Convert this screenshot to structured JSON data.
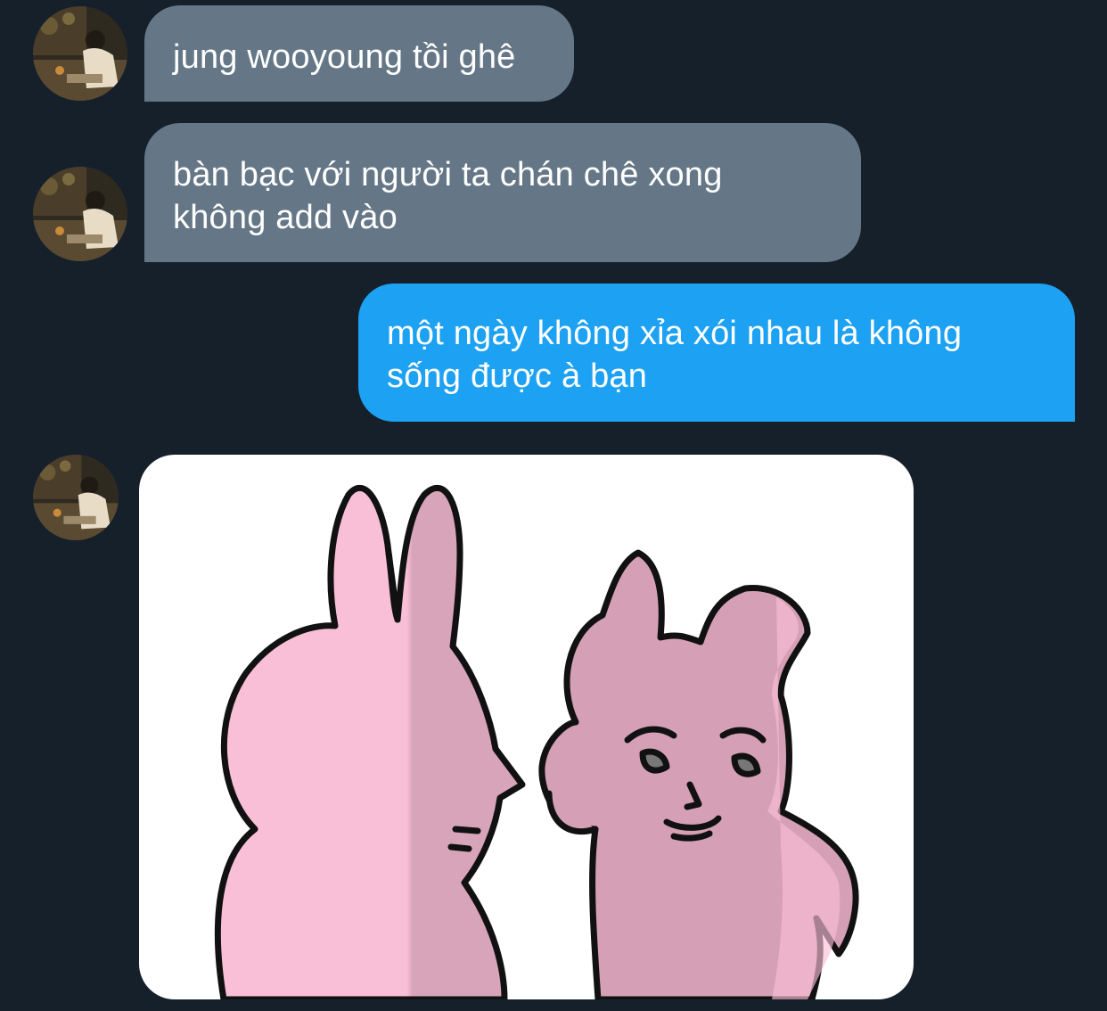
{
  "messages": [
    {
      "direction": "incoming",
      "lines": [
        "jung wooyoung tồi ghê"
      ]
    },
    {
      "direction": "incoming",
      "lines": [
        "bàn bạc với người ta chán chê xong",
        "không add vào"
      ]
    },
    {
      "direction": "outgoing",
      "lines": [
        "một ngày không xỉa xói nhau là không",
        "sống được à bạn"
      ]
    },
    {
      "direction": "incoming",
      "type": "sticker",
      "sticker": "pink-bunnies-smirk-sticker"
    }
  ],
  "colors": {
    "background": "#15202b",
    "incoming_bubble": "#657786",
    "outgoing_bubble": "#1da1f2",
    "text": "#ffffff",
    "bunny_pink": "#f9bfd6",
    "bunny_shade": "#d59fb5"
  }
}
